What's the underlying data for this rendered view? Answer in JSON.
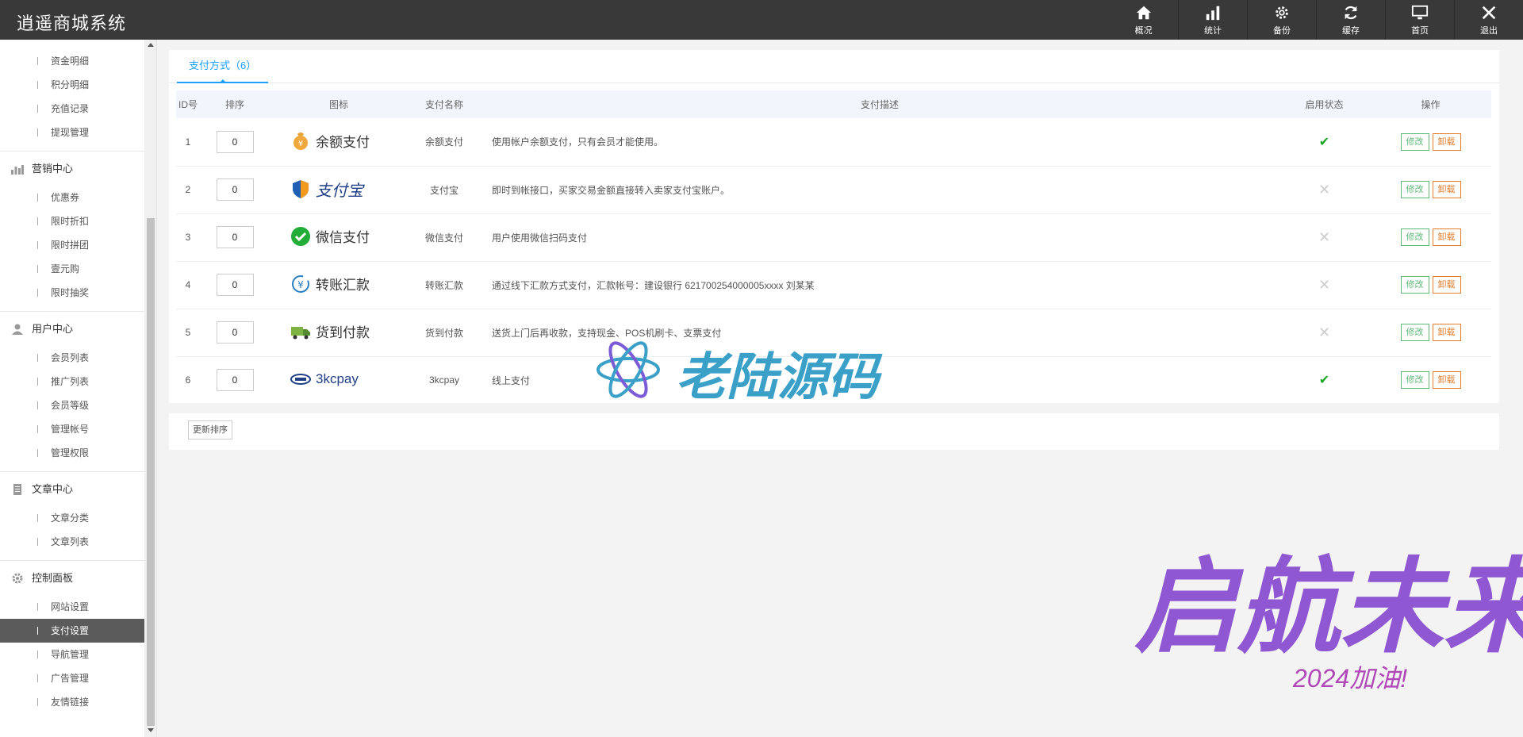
{
  "app": {
    "title": "逍遥商城系统"
  },
  "topnav": [
    {
      "label": "概况",
      "icon": "home-icon"
    },
    {
      "label": "统计",
      "icon": "bar-chart-icon"
    },
    {
      "label": "备份",
      "icon": "gear-icon"
    },
    {
      "label": "缓存",
      "icon": "refresh-icon"
    },
    {
      "label": "首页",
      "icon": "monitor-icon"
    },
    {
      "label": "退出",
      "icon": "close-icon"
    }
  ],
  "sidebar": {
    "top_items": [
      "资金明细",
      "积分明细",
      "充值记录",
      "提现管理"
    ],
    "groups": [
      {
        "label": "营销中心",
        "icon": "chart-icon",
        "items": [
          "优惠券",
          "限时折扣",
          "限时拼团",
          "壹元购",
          "限时抽奖"
        ]
      },
      {
        "label": "用户中心",
        "icon": "user-icon",
        "items": [
          "会员列表",
          "推广列表",
          "会员等级",
          "管理帐号",
          "管理权限"
        ]
      },
      {
        "label": "文章中心",
        "icon": "document-icon",
        "items": [
          "文章分类",
          "文章列表"
        ]
      },
      {
        "label": "控制面板",
        "icon": "gear-icon",
        "items": [
          "网站设置",
          "支付设置",
          "导航管理",
          "广告管理",
          "友情链接"
        ]
      }
    ],
    "active_item": "支付设置"
  },
  "tab": {
    "label": "支付方式（6）"
  },
  "table": {
    "headers": [
      "ID号",
      "排序",
      "图标",
      "支付名称",
      "支付描述",
      "启用状态",
      "操作"
    ],
    "rows": [
      {
        "id": "1",
        "sort": "0",
        "logo_text": "余额支付",
        "logo_icon": "money-bag-icon",
        "name": "余额支付",
        "desc": "使用帐户余额支付，只有会员才能使用。",
        "enabled": true
      },
      {
        "id": "2",
        "sort": "0",
        "logo_text": "支付宝",
        "logo_icon": "alipay-shield-icon",
        "name": "支付宝",
        "desc": "即时到帐接口，买家交易金额直接转入卖家支付宝账户。",
        "enabled": false
      },
      {
        "id": "3",
        "sort": "0",
        "logo_text": "微信支付",
        "logo_icon": "wechat-icon",
        "name": "微信支付",
        "desc": "用户使用微信扫码支付",
        "enabled": false
      },
      {
        "id": "4",
        "sort": "0",
        "logo_text": "转账汇款",
        "logo_icon": "transfer-icon",
        "name": "转账汇款",
        "desc": "通过线下汇款方式支付，汇款帐号：建设银行 621700254000005xxxx 刘某某",
        "enabled": false
      },
      {
        "id": "5",
        "sort": "0",
        "logo_text": "货到付款",
        "logo_icon": "truck-icon",
        "name": "货到付款",
        "desc": "送货上门后再收款，支持现金、POS机刷卡、支票支付",
        "enabled": false
      },
      {
        "id": "6",
        "sort": "0",
        "logo_text": "3kcpay",
        "logo_icon": "3kcpay-logo-icon",
        "name": "3kcpay",
        "desc": "线上支付",
        "enabled": true
      }
    ],
    "edit_label": "修改",
    "uninstall_label": "卸载"
  },
  "update_button": "更新排序",
  "overlays": {
    "watermark_text": "老陆源码",
    "deco_text": "启航未来",
    "deco_sub": "2024加油!"
  },
  "colors": {
    "topbar": "#393939",
    "accent": "#1e9fff",
    "ok": "#19a823",
    "edit": "#5fb878",
    "uninstall": "#e37c2b"
  }
}
